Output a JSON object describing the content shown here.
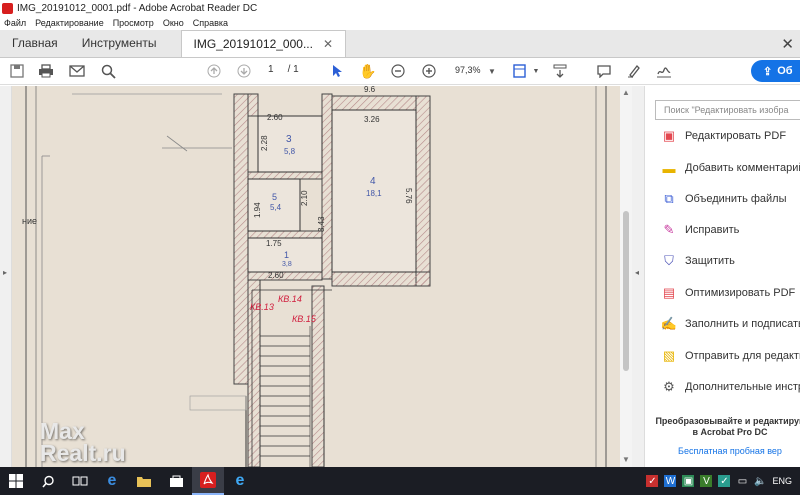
{
  "window": {
    "title": "IMG_20191012_0001.pdf - Adobe Acrobat Reader DC"
  },
  "menu": [
    "Файл",
    "Редактирование",
    "Просмотр",
    "Окно",
    "Справка"
  ],
  "tabs": {
    "home": "Главная",
    "tools": "Инструменты",
    "document": "IMG_20191012_000..."
  },
  "toolbar": {
    "page_current": "1",
    "page_total": "/ 1",
    "zoom": "97,3%",
    "share_label": "Об"
  },
  "floorplan": {
    "rooms": [
      {
        "num": "3",
        "area": "5,8"
      },
      {
        "num": "4",
        "area": "18,1"
      },
      {
        "num": "5",
        "area": "5,4"
      },
      {
        "num": "1",
        "area": "3,8"
      }
    ],
    "dims": [
      "2.60",
      "3.26",
      "2.28",
      "5.76",
      "1.94",
      "2.10",
      "3.43",
      "1.75",
      "2.60",
      "9.6"
    ],
    "stamps": [
      "КВ.13",
      "КВ.14",
      "КВ.15"
    ],
    "side_text": "ние"
  },
  "right_panel": {
    "search_placeholder": "Поиск \"Редактировать изобра",
    "items": [
      {
        "label": "Редактировать PDF",
        "icon": "edit-pdf-icon",
        "color": "#e34850"
      },
      {
        "label": "Добавить комментарий",
        "icon": "comment-icon",
        "color": "#e8b400"
      },
      {
        "label": "Объединить файлы",
        "icon": "combine-icon",
        "color": "#3d5fd6"
      },
      {
        "label": "Исправить",
        "icon": "fill-sign-icon",
        "color": "#c83da0"
      },
      {
        "label": "Защитить",
        "icon": "shield-icon",
        "color": "#5057b8"
      },
      {
        "label": "Оптимизировать PDF",
        "icon": "optimize-icon",
        "color": "#e34850"
      },
      {
        "label": "Заполнить и подписать",
        "icon": "pen-icon",
        "color": "#7c4dbf"
      },
      {
        "label": "Отправить для редакти",
        "icon": "send-icon",
        "color": "#e8b400"
      },
      {
        "label": "Дополнительные инстр",
        "icon": "more-tools-icon",
        "color": "#555555"
      }
    ],
    "promo": "Преобразовывайте и редактируй в Acrobat Pro DC",
    "trial": "Бесплатная пробная вер"
  },
  "taskbar": {
    "lang": "ENG"
  },
  "watermark": {
    "line1": "Max",
    "line2": "Realt.ru"
  }
}
